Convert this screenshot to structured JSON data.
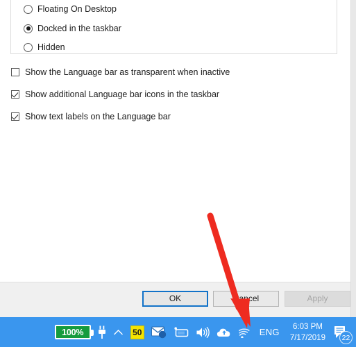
{
  "dialog": {
    "radio_group": {
      "name": "language-bar-position",
      "options": [
        {
          "label": "Floating On Desktop",
          "checked": false
        },
        {
          "label": "Docked in the taskbar",
          "checked": true
        },
        {
          "label": "Hidden",
          "checked": false
        }
      ]
    },
    "checkboxes": [
      {
        "label": "Show the Language bar as transparent when inactive",
        "checked": false
      },
      {
        "label": "Show additional Language bar icons in the taskbar",
        "checked": true
      },
      {
        "label": "Show text labels on the Language bar",
        "checked": true
      }
    ],
    "buttons": {
      "ok": "OK",
      "cancel": "Cancel",
      "apply": "Apply",
      "apply_disabled": true
    }
  },
  "taskbar": {
    "background_color": "#3a96ee",
    "battery": {
      "icon": "battery-icon",
      "level_text": "100%",
      "fill_color": "#159b3e"
    },
    "plug": {
      "icon": "plug-icon"
    },
    "show_hidden": {
      "icon": "chevron-up-icon"
    },
    "badge": {
      "icon": "yellow-badge-icon",
      "text": "50",
      "color": "#f5e400"
    },
    "mail": {
      "icon": "mail-icon"
    },
    "tablet": {
      "icon": "tablet-mode-icon"
    },
    "volume": {
      "icon": "volume-icon"
    },
    "cloud": {
      "icon": "onedrive-cloud-icon"
    },
    "network": {
      "icon": "wifi-icon"
    },
    "language": {
      "icon": "language-indicator",
      "text": "ENG"
    },
    "clock": {
      "time": "6:03 PM",
      "date": "7/17/2019"
    },
    "action_center": {
      "icon": "action-center-icon",
      "count": "22"
    }
  },
  "annotation": {
    "arrow": {
      "color": "#ee2b20",
      "points_to": "language-indicator"
    }
  }
}
